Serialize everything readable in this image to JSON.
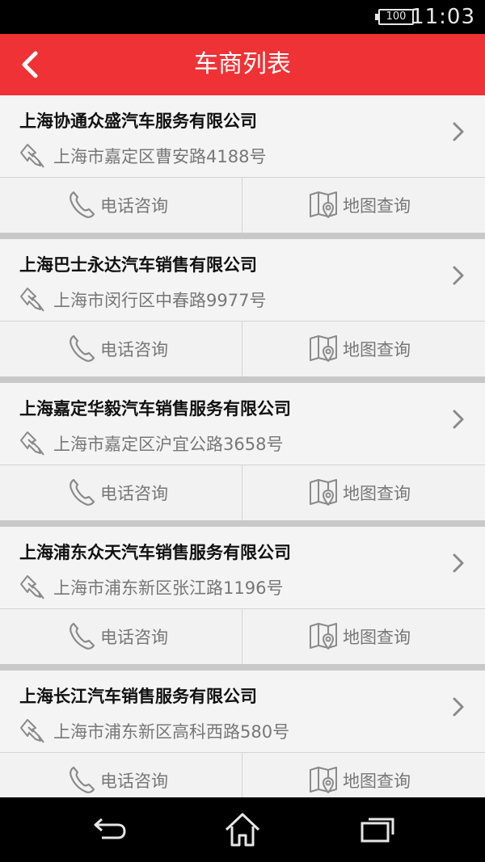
{
  "status_bar": {
    "battery": "100",
    "time": "11:03"
  },
  "header": {
    "title": "车商列表",
    "back_icon": "chevron-left-icon"
  },
  "colors": {
    "brand_red": "#ef3235",
    "card_bg": "#f4f4f4",
    "muted_text": "#777777"
  },
  "dealers": [
    {
      "name": "上海协通众盛汽车服务有限公司",
      "address": "上海市嘉定区曹安路4188号",
      "phone_label": "电话咨询",
      "map_label": "地图查询"
    },
    {
      "name": "上海巴士永达汽车销售有限公司",
      "address": "上海市闵行区中春路9977号",
      "phone_label": "电话咨询",
      "map_label": "地图查询"
    },
    {
      "name": "上海嘉定华毅汽车销售服务有限公司",
      "address": "上海市嘉定区沪宜公路3658号",
      "phone_label": "电话咨询",
      "map_label": "地图查询"
    },
    {
      "name": "上海浦东众天汽车销售服务有限公司",
      "address": "上海市浦东新区张江路1196号",
      "phone_label": "电话咨询",
      "map_label": "地图查询"
    },
    {
      "name": "上海长江汽车销售服务有限公司",
      "address": "上海市浦东新区高科西路580号",
      "phone_label": "电话咨询",
      "map_label": "地图查询"
    }
  ],
  "nav_bar": {
    "icons": [
      "back-icon",
      "home-icon",
      "recent-apps-icon"
    ]
  }
}
